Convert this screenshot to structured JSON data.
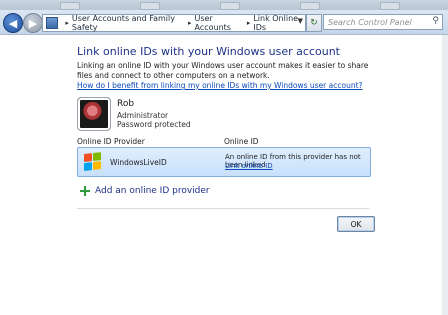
{
  "window": {
    "title": "Link Online IDs"
  },
  "navigation": {
    "breadcrumbs": [
      "User Accounts and Family Safety",
      "User Accounts",
      "Link Online IDs"
    ],
    "search_placeholder": "Search Control Panel"
  },
  "main": {
    "title": "Link online IDs with your Windows user account",
    "description": "Linking an online ID with your Windows user account makes it easier to share files and connect to other computers on a network.",
    "help_link": "How do I benefit from linking my online IDs with my Windows user account?",
    "user": {
      "name": "Rob",
      "role": "Administrator",
      "password_status": "Password protected"
    },
    "table": {
      "headers": [
        "Online ID Provider",
        "Online ID"
      ],
      "rows": [
        {
          "provider": "WindowsLiveID",
          "status": "An online ID from this provider has not been linked",
          "action": "Link online ID"
        }
      ]
    },
    "add_provider_label": "Add an online ID provider",
    "ok_label": "OK"
  },
  "colors": {
    "title_blue": "#1e3287",
    "link_blue": "#0b49b8",
    "selected_row_bg": "#d4e8fd",
    "selected_row_border": "#84acdd"
  },
  "icons": [
    "back-arrow-icon",
    "forward-arrow-icon",
    "control-panel-icon",
    "refresh-icon",
    "search-icon",
    "user-avatar-icon",
    "windows-logo-icon",
    "add-plus-icon"
  ]
}
